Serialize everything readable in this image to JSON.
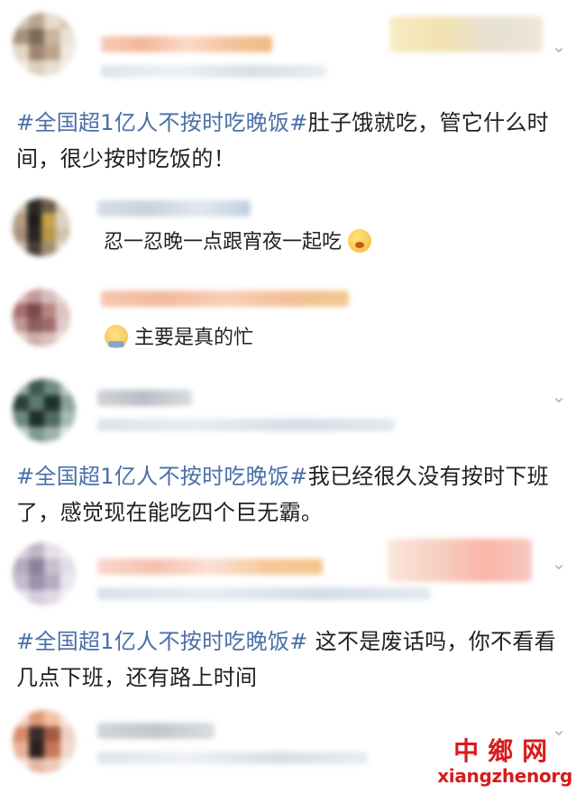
{
  "posts": [
    {
      "hashtag": "#全国超1亿人不按时吃晚饭#",
      "text_line1": "肚子饿就吃，管它什么时",
      "text_line2": "间，很少按时吃饭的！"
    },
    {
      "hashtag": "#全国超1亿人不按时吃晚饭#",
      "text_line1": "我已经很久没有按时下班",
      "text_line2": "了，感觉现在能吃四个巨无霸。"
    },
    {
      "hashtag": "#全国超1亿人不按时吃晚饭#",
      "text_line1": " 这不是废话吗，你不看看",
      "text_line2": "几点下班，还有路上时间"
    }
  ],
  "replies": [
    {
      "text": "忍一忍晚一点跟宵夜一起吃",
      "emoji": "yawn-emoji"
    },
    {
      "text": "主要是真的忙",
      "emoji": "tired-emoji"
    }
  ],
  "watermark": {
    "cn": "中鄉网",
    "en": "xiangzhenorg"
  },
  "colors": {
    "hashtag": "#4a6fa8",
    "watermark": "#d81b1b"
  }
}
